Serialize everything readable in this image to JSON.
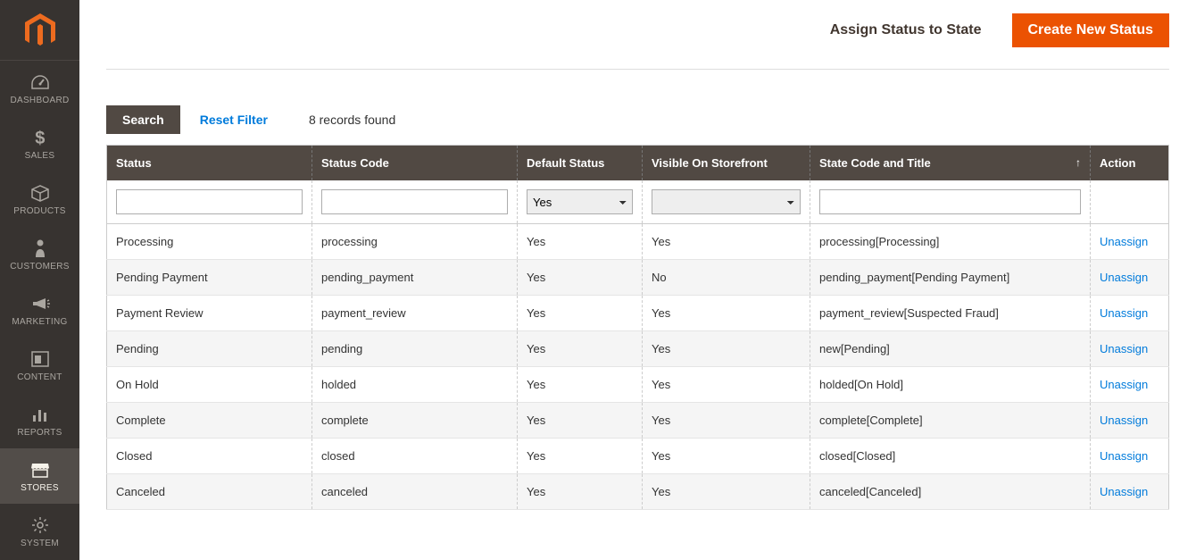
{
  "sidebar": {
    "items": [
      {
        "label": "DASHBOARD",
        "icon": "dashboard"
      },
      {
        "label": "SALES",
        "icon": "dollar"
      },
      {
        "label": "PRODUCTS",
        "icon": "box"
      },
      {
        "label": "CUSTOMERS",
        "icon": "person"
      },
      {
        "label": "MARKETING",
        "icon": "megaphone"
      },
      {
        "label": "CONTENT",
        "icon": "content"
      },
      {
        "label": "REPORTS",
        "icon": "bars"
      },
      {
        "label": "STORES",
        "icon": "stores"
      },
      {
        "label": "SYSTEM",
        "icon": "gear"
      }
    ],
    "activeIndex": 7
  },
  "actions": {
    "assign": "Assign Status to State",
    "create": "Create New Status"
  },
  "toolbar": {
    "search": "Search",
    "reset": "Reset Filter",
    "records": "8 records found"
  },
  "table": {
    "headers": {
      "status": "Status",
      "code": "Status Code",
      "default": "Default Status",
      "visible": "Visible On Storefront",
      "state": "State Code and Title",
      "action": "Action"
    },
    "sort_arrow": "↑",
    "filters": {
      "status": "",
      "code": "",
      "default": "Yes",
      "visible": "",
      "state": ""
    },
    "rows": [
      {
        "status": "Processing",
        "code": "processing",
        "default": "Yes",
        "visible": "Yes",
        "state": "processing[Processing]",
        "action": "Unassign"
      },
      {
        "status": "Pending Payment",
        "code": "pending_payment",
        "default": "Yes",
        "visible": "No",
        "state": "pending_payment[Pending Payment]",
        "action": "Unassign"
      },
      {
        "status": "Payment Review",
        "code": "payment_review",
        "default": "Yes",
        "visible": "Yes",
        "state": "payment_review[Suspected Fraud]",
        "action": "Unassign"
      },
      {
        "status": "Pending",
        "code": "pending",
        "default": "Yes",
        "visible": "Yes",
        "state": "new[Pending]",
        "action": "Unassign"
      },
      {
        "status": "On Hold",
        "code": "holded",
        "default": "Yes",
        "visible": "Yes",
        "state": "holded[On Hold]",
        "action": "Unassign"
      },
      {
        "status": "Complete",
        "code": "complete",
        "default": "Yes",
        "visible": "Yes",
        "state": "complete[Complete]",
        "action": "Unassign"
      },
      {
        "status": "Closed",
        "code": "closed",
        "default": "Yes",
        "visible": "Yes",
        "state": "closed[Closed]",
        "action": "Unassign"
      },
      {
        "status": "Canceled",
        "code": "canceled",
        "default": "Yes",
        "visible": "Yes",
        "state": "canceled[Canceled]",
        "action": "Unassign"
      }
    ]
  }
}
